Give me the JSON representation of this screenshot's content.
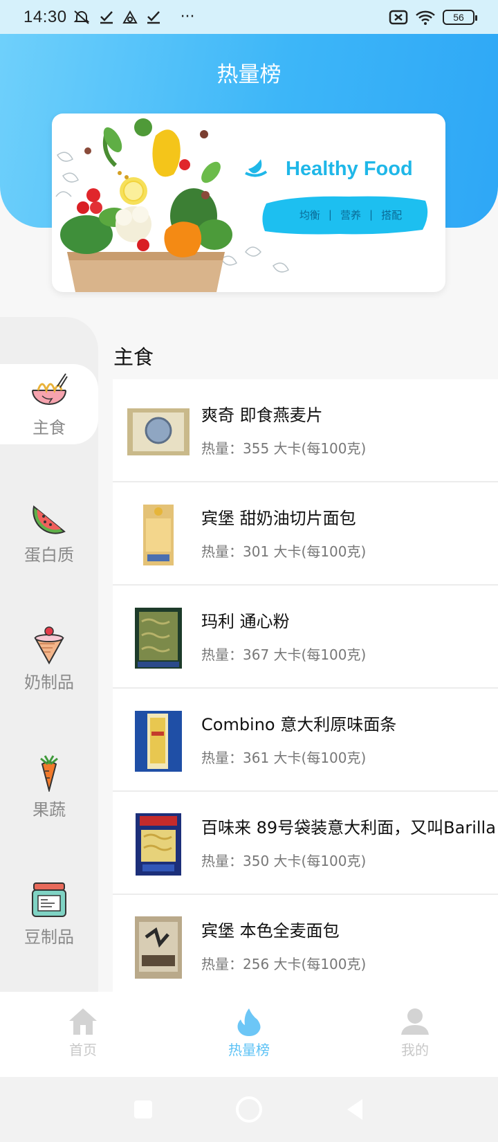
{
  "status_bar": {
    "time": "14:30",
    "more": "···",
    "battery": "56"
  },
  "header": {
    "title": "热量榜"
  },
  "banner": {
    "brand": "Healthy Food",
    "tags": [
      "均衡",
      "营养",
      "搭配"
    ]
  },
  "sidebar": {
    "categories": [
      {
        "label": "主食",
        "icon": "noodle-bowl-icon"
      },
      {
        "label": "蛋白质",
        "icon": "watermelon-icon"
      },
      {
        "label": "奶制品",
        "icon": "ice-cream-icon"
      },
      {
        "label": "果蔬",
        "icon": "carrot-icon"
      },
      {
        "label": "豆制品",
        "icon": "jar-icon"
      }
    ],
    "active_index": 0
  },
  "main": {
    "section_title": "主食",
    "items": [
      {
        "name": "爽奇 即食燕麦片",
        "kcal": "热量：355 大卡(每100克)"
      },
      {
        "name": "宾堡 甜奶油切片面包",
        "kcal": "热量：301 大卡(每100克)"
      },
      {
        "name": "玛利 通心粉",
        "kcal": "热量：367 大卡(每100克)"
      },
      {
        "name": "Combino 意大利原味面条",
        "kcal": "热量：361 大卡(每100克)"
      },
      {
        "name": "百味来 89号袋装意大利面，又叫Barilla",
        "kcal": "热量：350 大卡(每100克)"
      },
      {
        "name": "宾堡 本色全麦面包",
        "kcal": "热量：256 大卡(每100克)"
      }
    ]
  },
  "bottom_nav": {
    "items": [
      {
        "label": "首页",
        "icon": "home-icon"
      },
      {
        "label": "热量榜",
        "icon": "flame-icon"
      },
      {
        "label": "我的",
        "icon": "user-icon"
      }
    ],
    "active_index": 1
  },
  "colors": {
    "accent": "#3db6f8",
    "active_label": "#5cc2f5",
    "banner_brand": "#1fb7e8"
  }
}
